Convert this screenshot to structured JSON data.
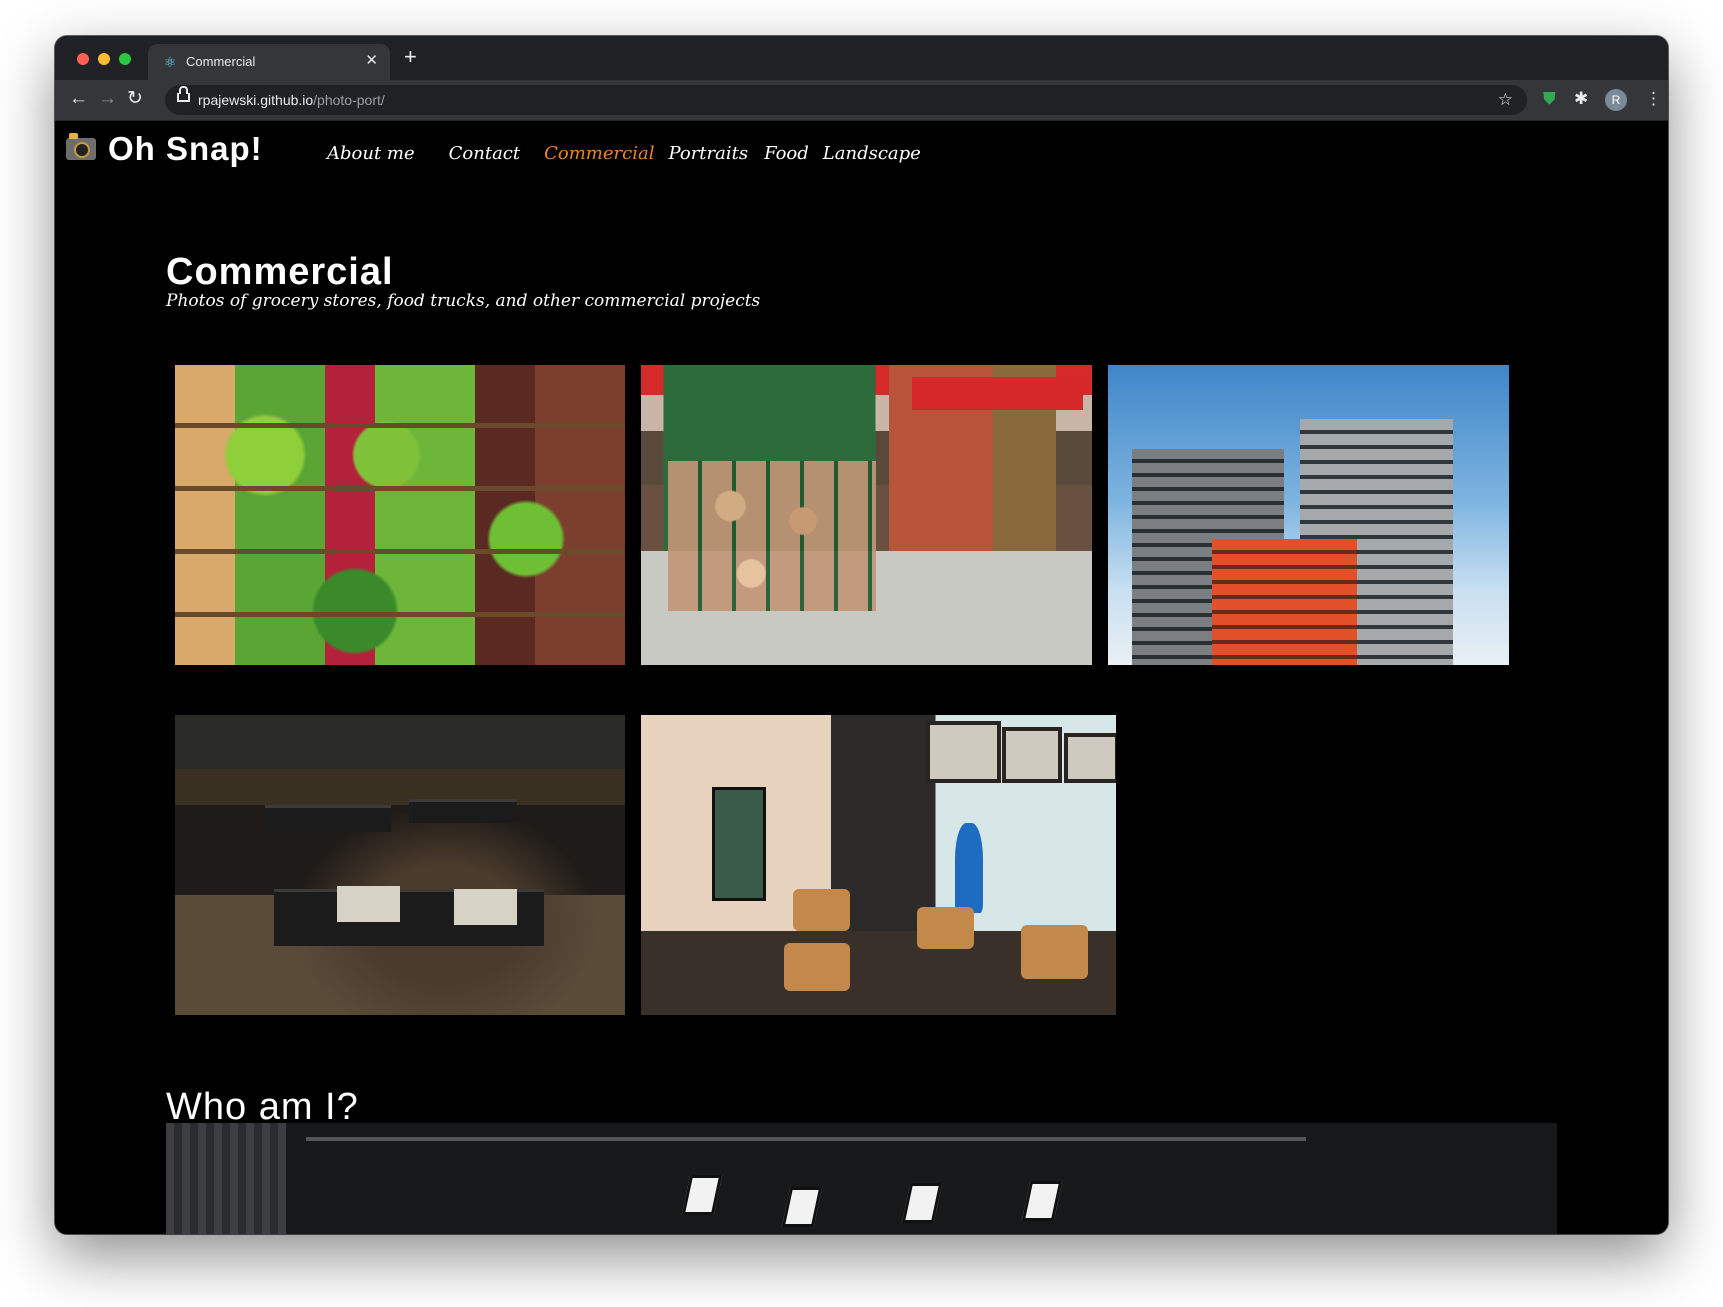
{
  "browser": {
    "tab_title": "Commercial",
    "tab_icon": "react-icon",
    "url_host": "rpajewski.github.io",
    "url_path": "/photo-port/",
    "profile_initial": "R"
  },
  "site": {
    "brand": "Oh Snap!",
    "nav": [
      {
        "label": "About me",
        "active": false
      },
      {
        "label": "Contact",
        "active": false
      },
      {
        "label": "Commercial",
        "active": true
      },
      {
        "label": "Portraits",
        "active": false
      },
      {
        "label": "Food",
        "active": false
      },
      {
        "label": "Landscape",
        "active": false
      }
    ]
  },
  "gallery": {
    "title": "Commercial",
    "description": "Photos of grocery stores, food trucks, and other commercial projects",
    "photos": [
      {
        "subject": "produce shelves"
      },
      {
        "subject": "grocery aisle"
      },
      {
        "subject": "apartment building"
      },
      {
        "subject": "restaurant tables"
      },
      {
        "subject": "cafe interior"
      }
    ]
  },
  "about": {
    "title": "Who am I?"
  },
  "colors": {
    "accent": "#e8852a",
    "page_bg": "#000000",
    "text": "#ffffff"
  }
}
